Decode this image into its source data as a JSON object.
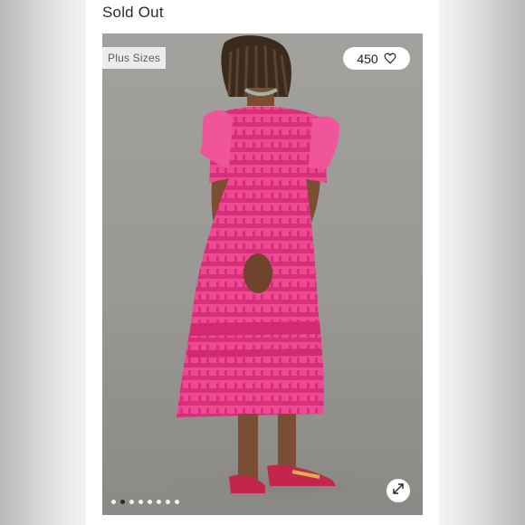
{
  "listing": {
    "status": "Sold Out",
    "size_tag": "Plus Sizes",
    "likes": "450",
    "gallery": {
      "total_images": 8,
      "active_index": 1
    }
  },
  "icons": {
    "like": "heart-icon",
    "expand": "expand-icon"
  },
  "colors": {
    "dress_primary": "#ec3f8c",
    "dress_stripe": "#d62f74",
    "background": "#9d9b97",
    "card": "#ffffff"
  }
}
